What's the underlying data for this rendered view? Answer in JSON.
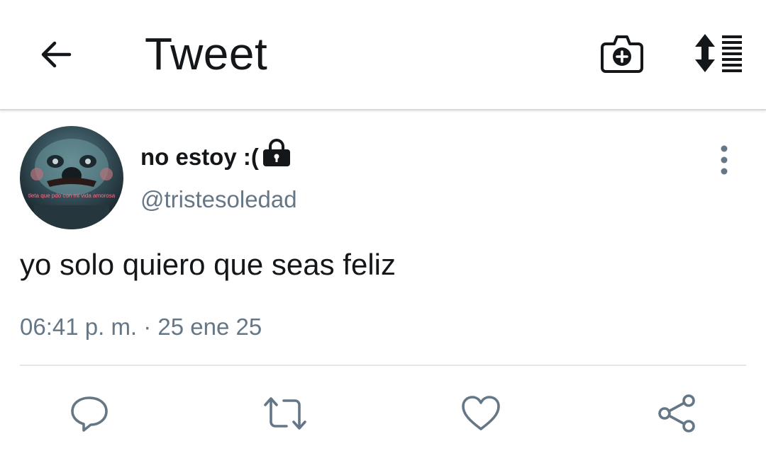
{
  "header": {
    "title": "Tweet",
    "back_icon": "arrow-left-icon",
    "camera_icon": "camera-plus-icon",
    "sort_icon": "sort-list-icon"
  },
  "tweet": {
    "avatar_caption": "tleta que pdo con mi vida amorosa",
    "display_name": "no estoy :(",
    "protected_icon": "lock-icon",
    "username": "@tristesoledad",
    "text": "yo solo quiero que seas feliz",
    "timestamp": "06:41 p. m. · 25 ene 25",
    "more_icon": "more-vertical-icon"
  },
  "actions": {
    "reply_icon": "reply-icon",
    "retweet_icon": "retweet-icon",
    "like_icon": "heart-icon",
    "share_icon": "share-icon"
  },
  "colors": {
    "text_primary": "#14171a",
    "text_secondary": "#657786",
    "icon_gray": "#657786",
    "divider": "#e1e8ed"
  }
}
